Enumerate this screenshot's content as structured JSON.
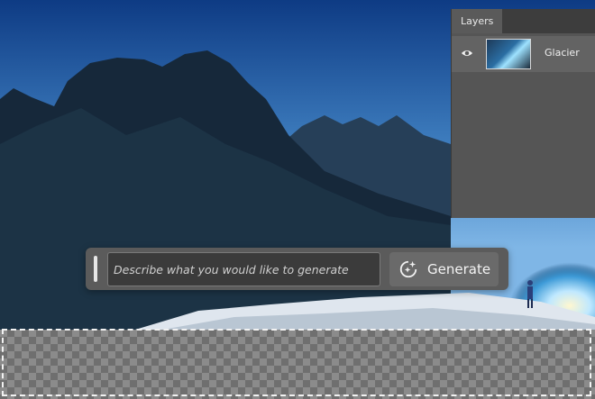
{
  "layers_panel": {
    "tab_label": "Layers",
    "layers": [
      {
        "name": "Glacier",
        "visible": true,
        "visibility_icon": "eye-icon"
      }
    ]
  },
  "generative_fill": {
    "prompt_placeholder": "Describe what you would like to generate",
    "prompt_value": "",
    "generate_label": "Generate",
    "generate_icon": "sparkle-generate-icon"
  },
  "canvas": {
    "transparent_area": true
  },
  "colors": {
    "panel_bg": "#555555",
    "panel_header": "#3d3d3d",
    "prompt_bar_bg": "#5b5b5b",
    "input_bg": "#3b3b3b"
  }
}
